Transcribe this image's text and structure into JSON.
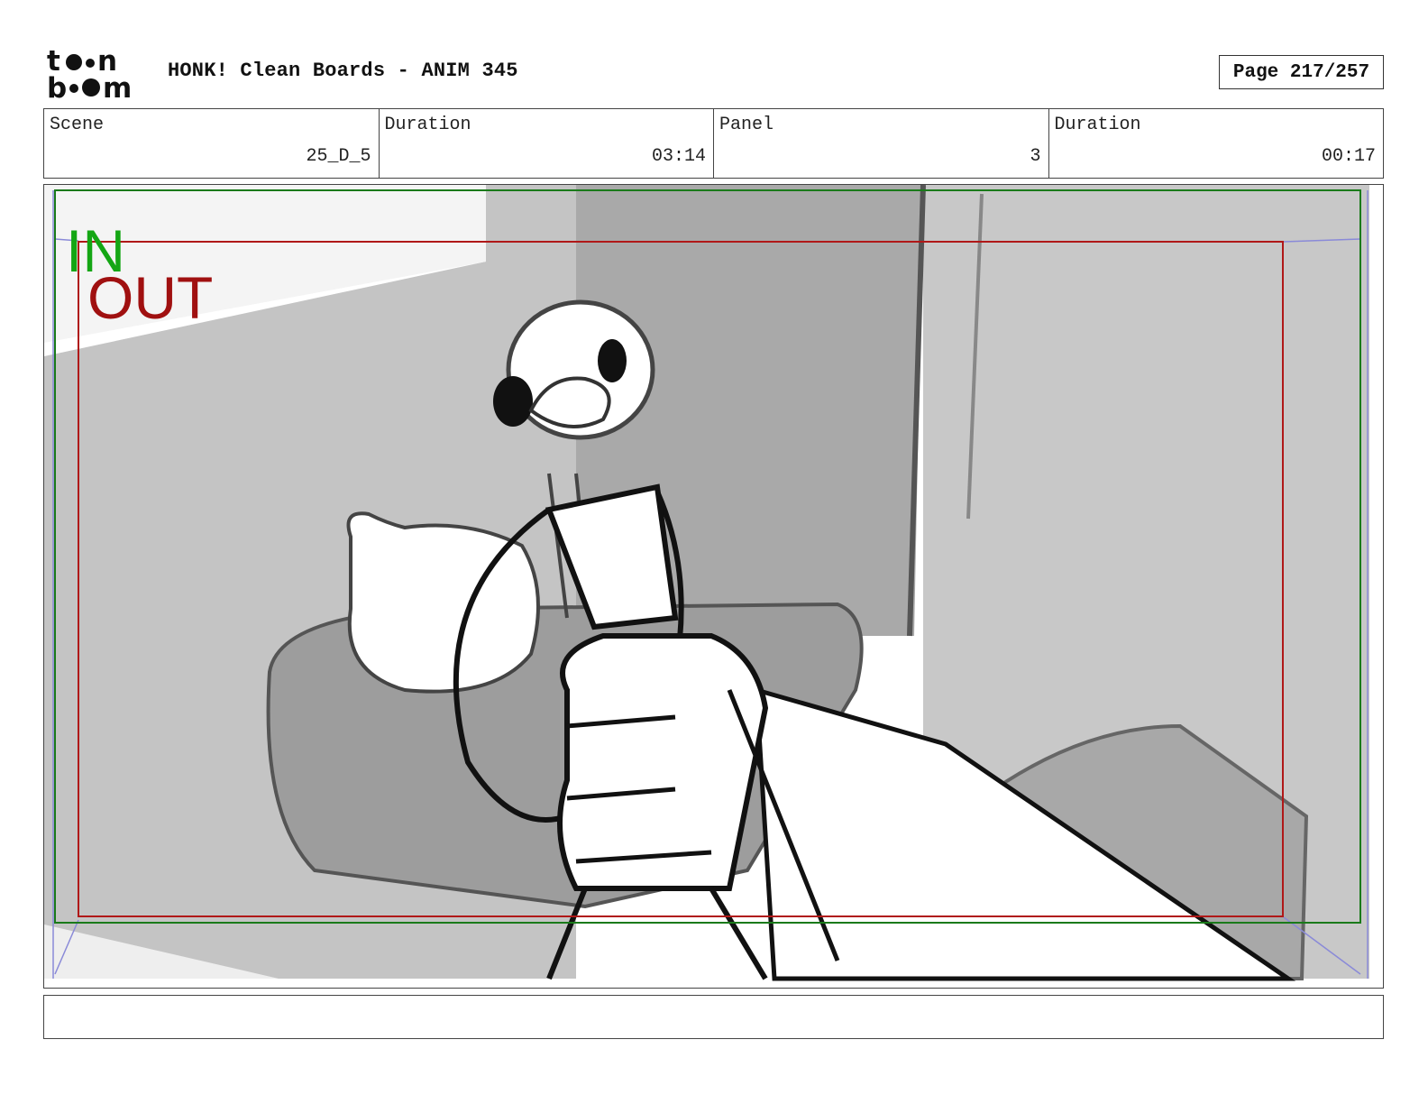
{
  "header": {
    "logo_text_top": "toon",
    "logo_text_bottom": "boom",
    "title": "HONK! Clean Boards - ANIM 345",
    "page": "Page 217/257"
  },
  "info": {
    "scene_label": "Scene",
    "scene_value": "25_D_5",
    "duration_label": "Duration",
    "duration_value": "03:14",
    "panel_label": "Panel",
    "panel_value": "3",
    "panel_duration_label": "Duration",
    "panel_duration_value": "00:17"
  },
  "panel": {
    "in_label": "IN",
    "out_label": "OUT",
    "colors": {
      "in_frame": "#1a7a1a",
      "in_text": "#14a614",
      "out_frame": "#b01818",
      "out_text": "#a01010",
      "camera_guides": "#8a8ad8"
    }
  },
  "notes": {
    "text": ""
  }
}
